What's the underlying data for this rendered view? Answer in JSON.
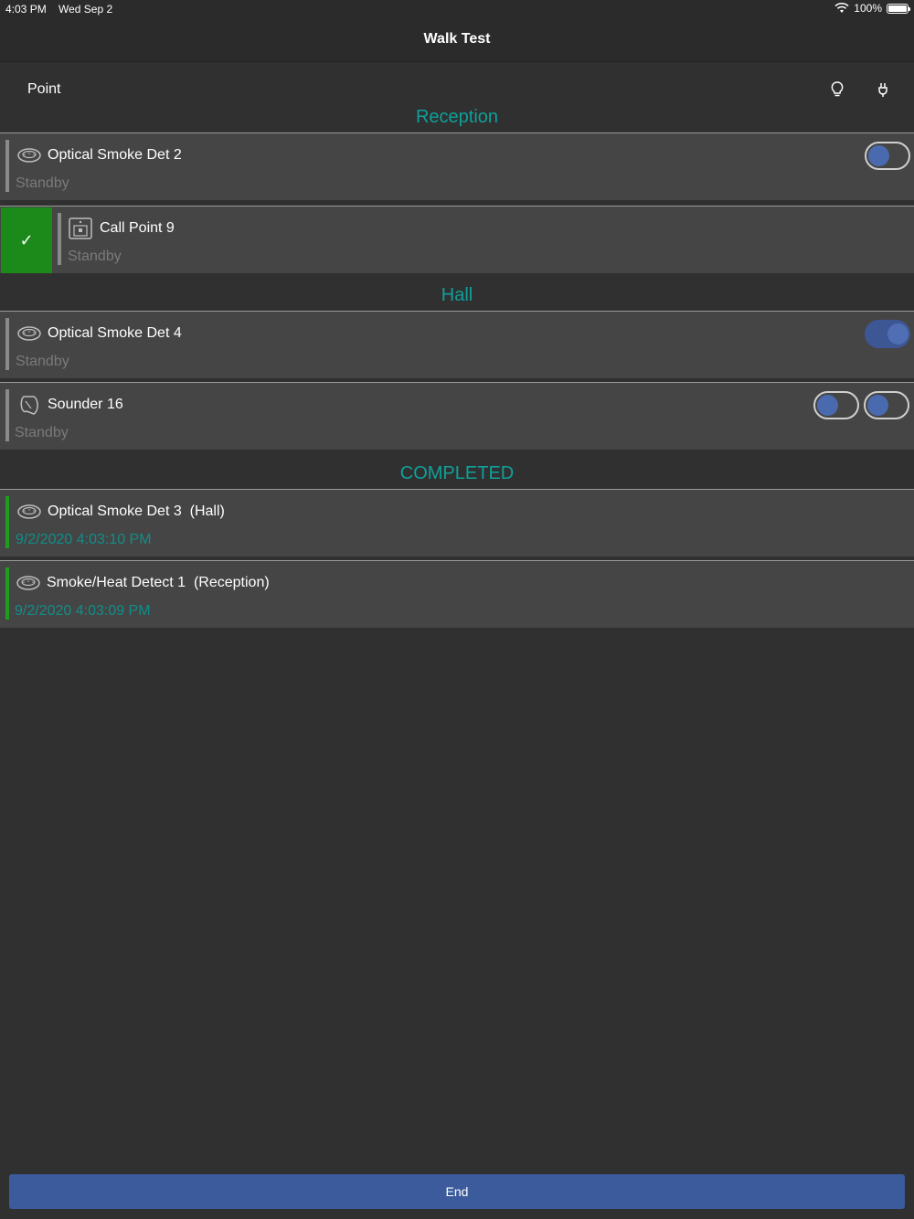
{
  "status_bar": {
    "time": "4:03 PM",
    "date": "Wed Sep 2",
    "battery": "100%"
  },
  "nav": {
    "title": "Walk Test"
  },
  "header": {
    "label": "Point",
    "icons": [
      "lightbulb-icon",
      "plug-icon"
    ]
  },
  "sections": {
    "reception": {
      "title": "Reception",
      "items": [
        {
          "name": "Optical Smoke Det 2",
          "status": "Standby",
          "icon": "smoke-detector-icon",
          "toggle_on": false
        },
        {
          "name": "Call Point 9",
          "status": "Standby",
          "icon": "call-point-icon",
          "checked": true
        }
      ]
    },
    "hall": {
      "title": "Hall",
      "items": [
        {
          "name": "Optical Smoke Det 4",
          "status": "Standby",
          "icon": "smoke-detector-icon",
          "toggle_on": true
        },
        {
          "name": "Sounder 16",
          "status": "Standby",
          "icon": "sounder-icon",
          "toggles_on": [
            false,
            false
          ]
        }
      ]
    },
    "completed": {
      "title": "COMPLETED",
      "items": [
        {
          "name": "Optical Smoke Det 3  (Hall)",
          "timestamp": "9/2/2020 4:03:10 PM",
          "icon": "smoke-detector-icon"
        },
        {
          "name": "Smoke/Heat Detect 1  (Reception)",
          "timestamp": "9/2/2020 4:03:09 PM",
          "icon": "smoke-detector-icon"
        }
      ]
    }
  },
  "footer": {
    "end_label": "End"
  },
  "colors": {
    "accent": "#0fa09a",
    "completed_bar": "#1f9b1f",
    "toggle_blue": "#4a6aaf",
    "end_button": "#3b5b9c"
  }
}
